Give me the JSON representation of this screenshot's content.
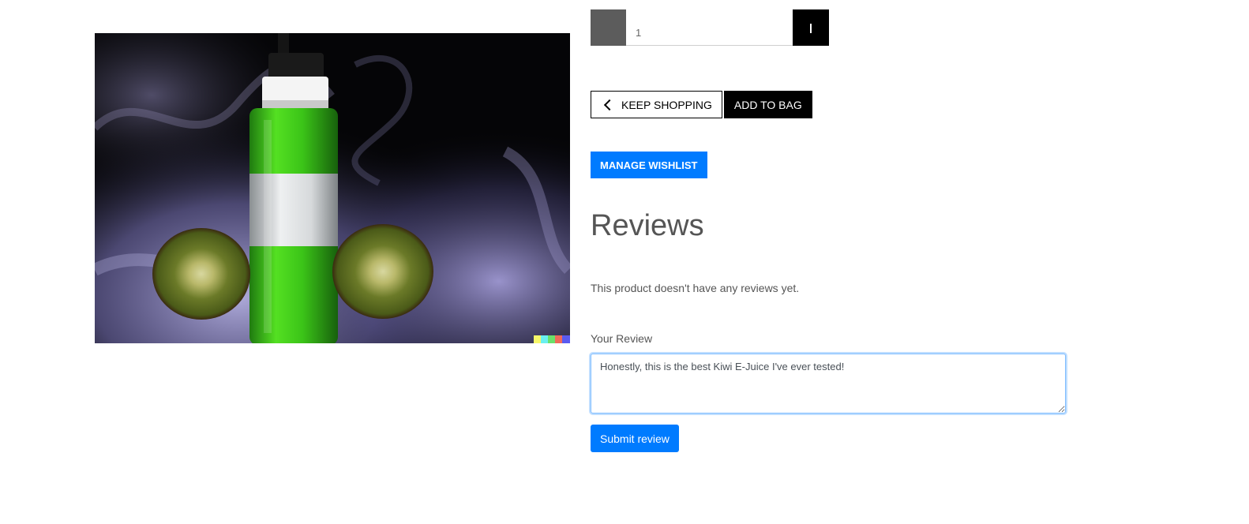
{
  "product": {
    "image_icon": "kiwi-e-juice-bottle-image"
  },
  "quantity": {
    "value": "1"
  },
  "actions": {
    "keep_shopping_label": "KEEP SHOPPING",
    "add_to_bag_label": "ADD TO BAG",
    "manage_wishlist_label": "MANAGE WISHLIST"
  },
  "reviews": {
    "title": "Reviews",
    "empty_message": "This product doesn't have any reviews yet.",
    "field_label": "Your Review",
    "field_value": "Honestly, this is the best Kiwi E-Juice I've ever tested!",
    "submit_label": "Submit review"
  },
  "colors": {
    "primary": "#007bff",
    "dark": "#000000",
    "text": "#555555"
  }
}
